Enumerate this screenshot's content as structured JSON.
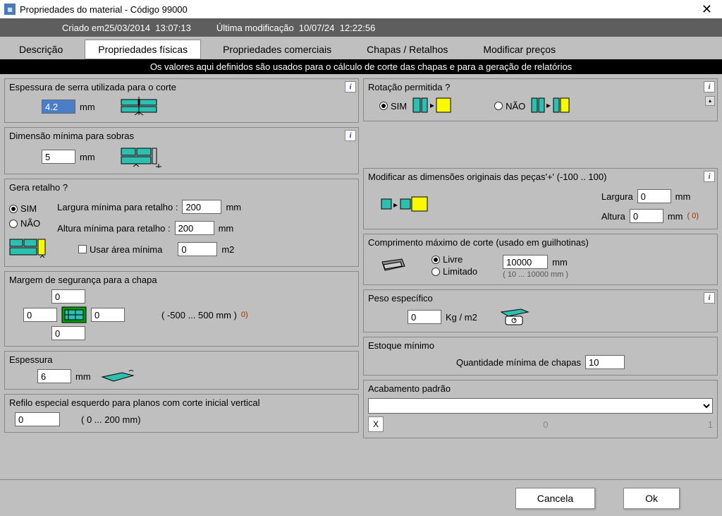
{
  "window": {
    "title": "Propriedades do material - Código 99000"
  },
  "meta": {
    "created": "Criado em25/03/2014  13:07:13",
    "modified": "Última modificação  10/07/24  12:22:56"
  },
  "tabs": {
    "t0": "Descrição",
    "t1": "Propriedades físicas",
    "t2": "Propriedades comerciais",
    "t3": "Chapas / Retalhos",
    "t4": "Modificar preços"
  },
  "banner": "Os valores aqui definidos são usados para o cálculo de corte das chapas e para a geração de relatórios",
  "left": {
    "saw": {
      "title": "Espessura de serra utilizada para o corte",
      "value": "4.2",
      "unit": "mm"
    },
    "minDim": {
      "title": "Dimensão mínima para sobras",
      "value": "5",
      "unit": "mm"
    },
    "scrap": {
      "title": "Gera retalho ?",
      "yes": "SIM",
      "no": "NÃO",
      "wlabel": "Largura mínima para retalho :",
      "hlabel": "Altura mínima para retalho :",
      "w": "200",
      "h": "200",
      "unit": "mm",
      "useArea": "Usar área mínima",
      "area": "0",
      "areaUnit": "m2"
    },
    "margin": {
      "title": "Margem de segurança para a chapa",
      "top": "0",
      "left": "0",
      "right": "0",
      "bottom": "0",
      "hint1": "( -500 ... 500 mm )",
      "hint2": "0)"
    },
    "thick": {
      "title": "Espessura",
      "value": "6",
      "unit": "mm"
    },
    "refilo": {
      "title": "Refilo especial esquerdo para planos com corte inicial vertical",
      "value": "0",
      "hint": "( 0 ... 200 mm)"
    }
  },
  "right": {
    "rot": {
      "title": "Rotação permitida ?",
      "yes": "SIM",
      "no": "NÃO"
    },
    "modDim": {
      "title": "Modificar as dimensões originais das peças'+' (-100 .. 100)",
      "wlabel": "Largura",
      "hlabel": "Altura",
      "w": "0",
      "h": "0",
      "unit": "mm",
      "hhint": "( 0)"
    },
    "maxCut": {
      "title": "Comprimento máximo de corte (usado em guilhotinas)",
      "free": "Livre",
      "limited": "Limitado",
      "value": "10000",
      "unit": "mm",
      "hint": "( 10 ... 10000 mm )"
    },
    "weight": {
      "title": "Peso específico",
      "value": "0",
      "unit": "Kg / m2"
    },
    "stock": {
      "title": "Estoque mínimo",
      "label": "Quantidade mínima de chapas",
      "value": "10"
    },
    "finish": {
      "title": "Acabamento padrão",
      "x": "X",
      "zc": "0",
      "lc": "1"
    }
  },
  "footer": {
    "cancel": "Cancela",
    "ok": "Ok"
  },
  "info": "i"
}
